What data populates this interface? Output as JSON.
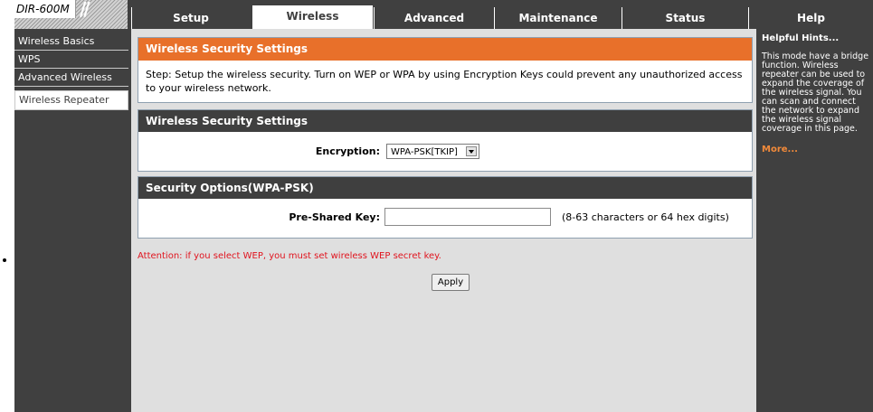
{
  "header": {
    "logo_text": "DIR-600M",
    "tabs": [
      {
        "label": "Setup"
      },
      {
        "label": "Wireless"
      },
      {
        "label": "Advanced"
      },
      {
        "label": "Maintenance"
      },
      {
        "label": "Status"
      },
      {
        "label": "Help"
      }
    ],
    "active_tab": "Wireless"
  },
  "sidebar": {
    "items": [
      {
        "label": "Wireless Basics"
      },
      {
        "label": "WPS"
      },
      {
        "label": "Advanced Wireless"
      },
      {
        "label": "Wireless Repeater"
      }
    ],
    "selected": "Wireless Repeater"
  },
  "main": {
    "intro": {
      "title": "Wireless Security Settings",
      "text": "Step: Setup the wireless security. Turn on WEP or WPA by using Encryption Keys could prevent any unauthorized access to your wireless network."
    },
    "security": {
      "title": "Wireless Security Settings",
      "encryption_label": "Encryption:",
      "encryption_value": "WPA-PSK[TKIP]"
    },
    "options": {
      "title": "Security Options(WPA-PSK)",
      "psk_label": "Pre-Shared Key:",
      "psk_value": "",
      "psk_hint": "(8-63 characters or 64 hex digits)"
    },
    "attention": "Attention: if you select WEP, you must set wireless WEP secret key.",
    "apply_label": "Apply"
  },
  "help": {
    "title": "Helpful Hints...",
    "text": "This mode have a bridge function. Wireless repeater can be used to expand the coverage of the wireless signal. You can scan and connect the network to expand the wireless signal coverage in this page.",
    "more": "More..."
  },
  "colors": {
    "frame": "#404040",
    "orange_header": "#e8702a",
    "dark_header": "#3f3f3f",
    "attention": "#e0141e",
    "more_link": "#f28a3a"
  }
}
